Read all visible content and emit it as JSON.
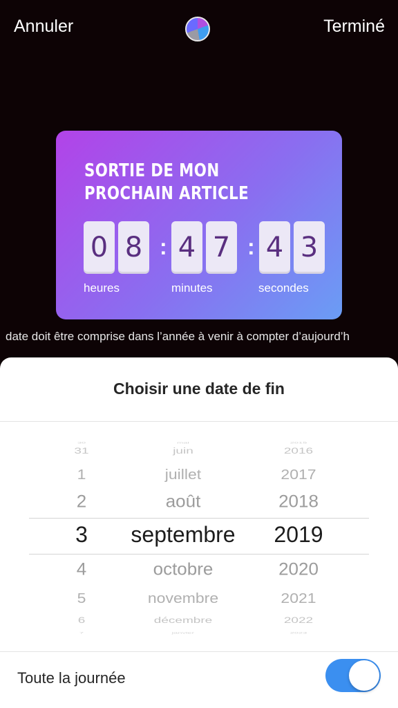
{
  "header": {
    "cancel_label": "Annuler",
    "done_label": "Terminé"
  },
  "countdown": {
    "title_line1": "Sortie de mon",
    "title_line2": "prochain article",
    "digits": [
      "0",
      "8",
      "4",
      "7",
      "4",
      "3"
    ],
    "separator": ":",
    "units": {
      "hours": "heures",
      "minutes": "minutes",
      "seconds": "secondes"
    }
  },
  "notice_text": "date doit être comprise dans l’année à venir à compter d’aujourd’h",
  "sheet": {
    "title": "Choisir une date de fin",
    "picker": {
      "days": [
        "30",
        "31",
        "1",
        "2",
        "3",
        "4",
        "5",
        "6",
        "7"
      ],
      "months": [
        "mai",
        "juin",
        "juillet",
        "août",
        "septembre",
        "octobre",
        "novembre",
        "décembre",
        "janvier"
      ],
      "years": [
        "2015",
        "2016",
        "2017",
        "2018",
        "2019",
        "2020",
        "2021",
        "2022",
        "2023"
      ],
      "selected": {
        "day": "3",
        "month": "septembre",
        "year": "2019"
      }
    },
    "all_day_label": "Toute la journée",
    "all_day_on": true
  },
  "colors": {
    "accent": "#3b8ff0",
    "card_gradient_start": "#b243e8",
    "card_gradient_end": "#6a9df5",
    "digit_color": "#5a2f80"
  }
}
